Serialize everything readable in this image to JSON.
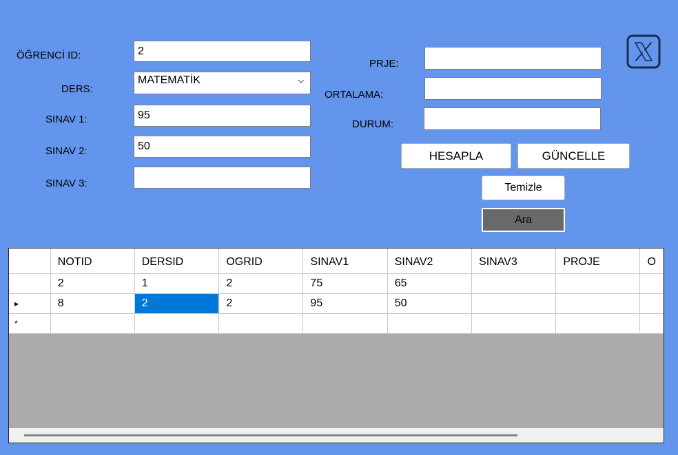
{
  "form": {
    "ogrenci_id_label": "ÖĞRENCİ ID:",
    "ogrenci_id_value": "2",
    "ders_label": "DERS:",
    "ders_value": "MATEMATİK",
    "sinav1_label": "SINAV 1:",
    "sinav1_value": "95",
    "sinav2_label": "SINAV 2:",
    "sinav2_value": "50",
    "sinav3_label": "SINAV 3:",
    "sinav3_value": "",
    "proje_label": "PRJE:",
    "proje_value": "",
    "ortalama_label": "ORTALAMA:",
    "ortalama_value": "",
    "durum_label": "DURUM:",
    "durum_value": ""
  },
  "buttons": {
    "hesapla": "HESAPLA",
    "guncelle": "GÜNCELLE",
    "temizle": "Temizle",
    "ara": "Ara"
  },
  "close_icon": "close-x-icon",
  "grid": {
    "columns": [
      "NOTID",
      "DERSID",
      "OGRID",
      "SINAV1",
      "SINAV2",
      "SINAV3",
      "PROJE"
    ],
    "rows": [
      [
        "2",
        "1",
        "2",
        "75",
        "65",
        "",
        ""
      ],
      [
        "8",
        "2",
        "2",
        "95",
        "50",
        "",
        ""
      ]
    ],
    "current_row_marker": "▸",
    "new_row_marker": "*"
  },
  "colors": {
    "background": "#6495ED",
    "selection": "#0078d7",
    "grid_empty": "#ababab",
    "ara_button": "#696969"
  }
}
